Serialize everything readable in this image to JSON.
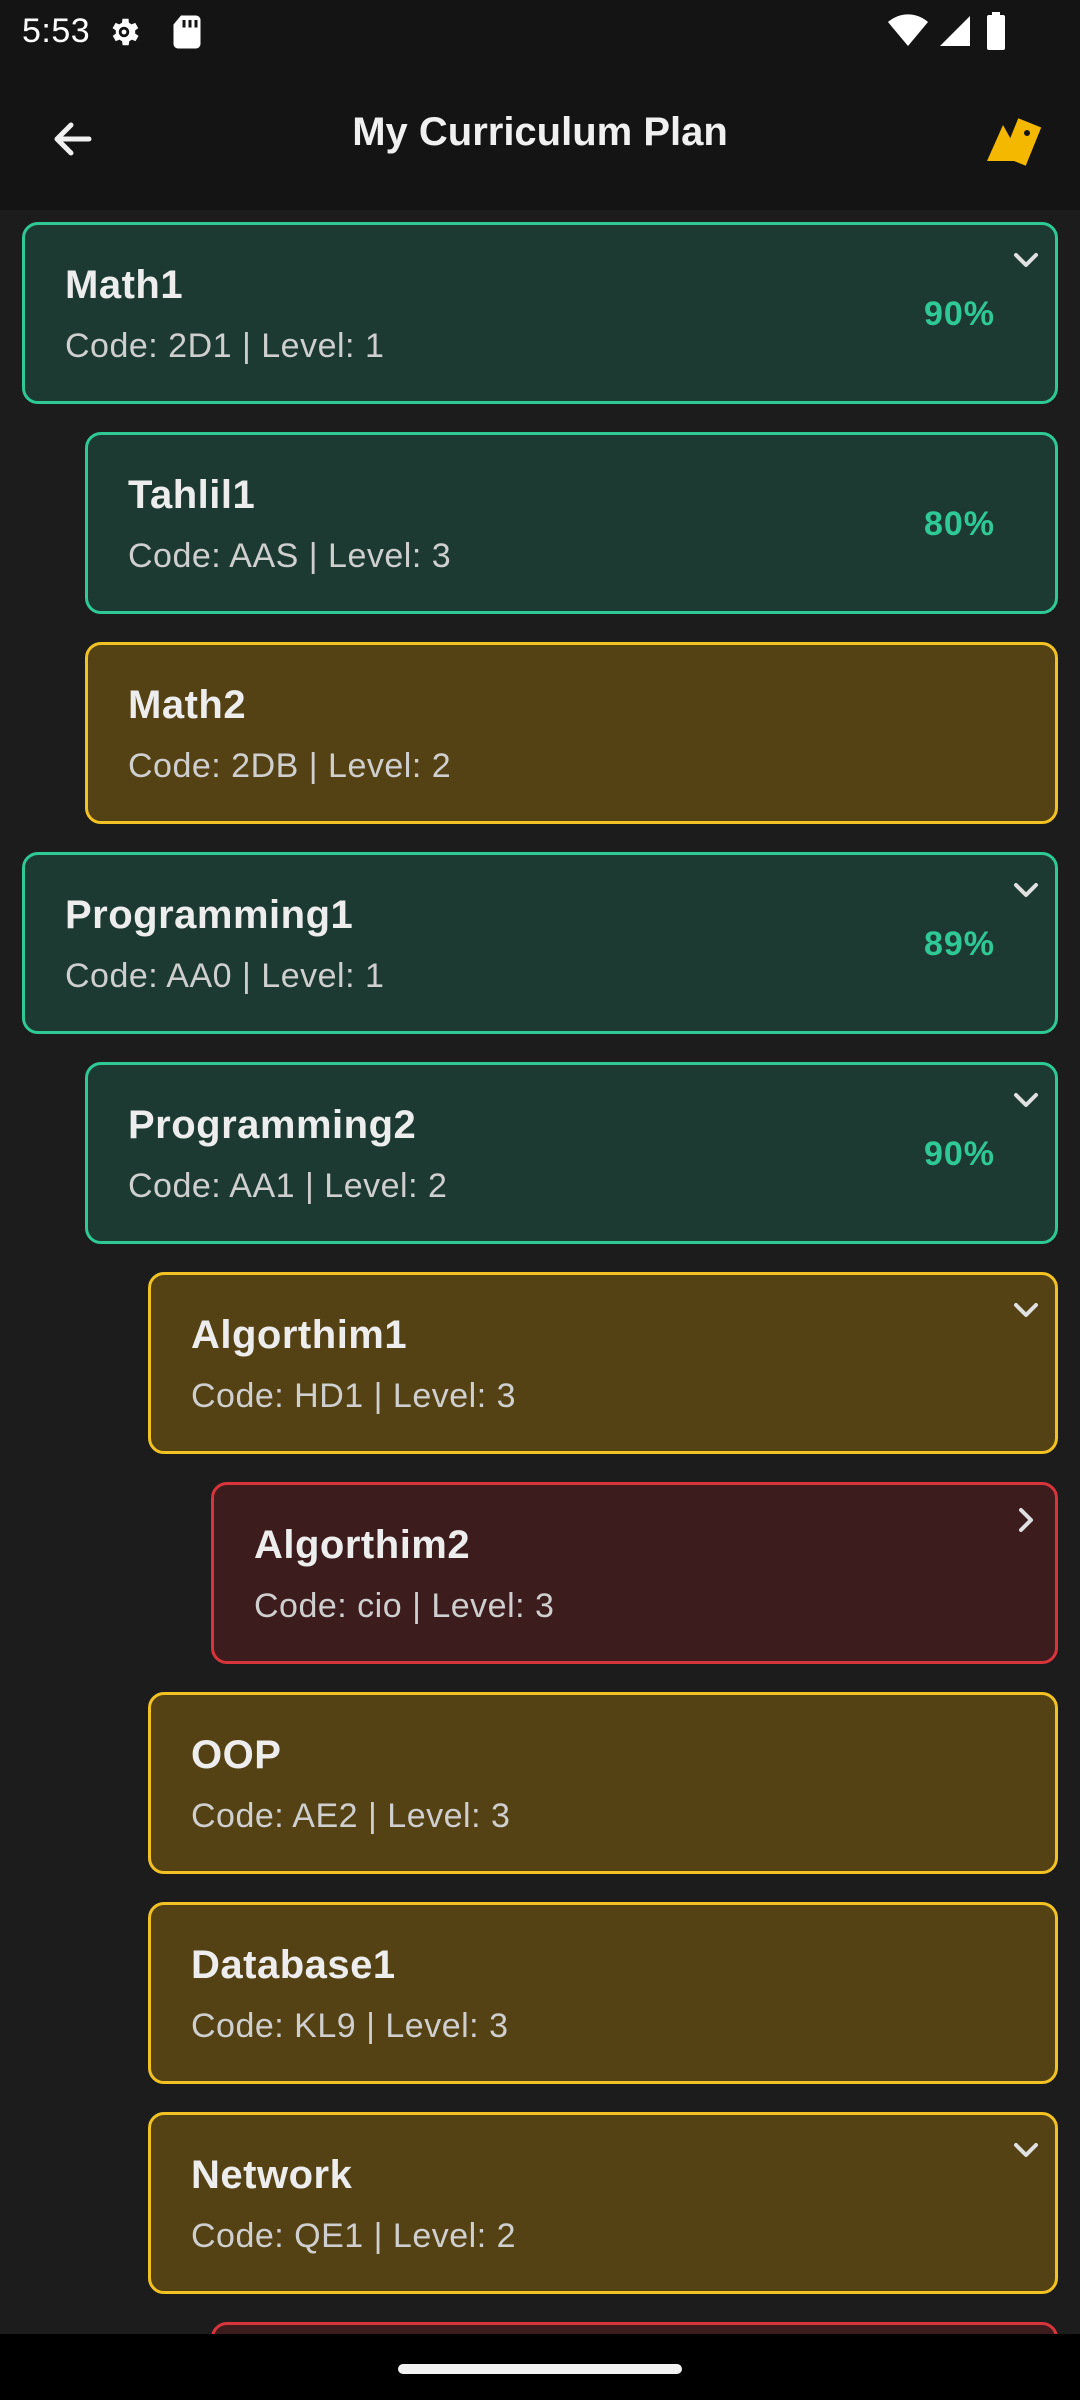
{
  "status_bar": {
    "time": "5:53",
    "icons": [
      "gear-icon",
      "sd-card-icon",
      "wifi-icon",
      "signal-icon",
      "battery-icon"
    ]
  },
  "app_bar": {
    "title": "My Curriculum Plan",
    "back_icon": "arrow-left-icon",
    "action_icon": "tag-icon"
  },
  "colors": {
    "passed_bg": "#1c3a32",
    "passed_border": "#2ec995",
    "available_bg": "#544214",
    "available_border": "#f2c224",
    "locked_bg": "#3c1c1c",
    "locked_border": "#d8343c",
    "accent": "#f5b800"
  },
  "courses": [
    {
      "title": "Math1",
      "sub": "Code: 2D1 | Level: 1",
      "percent": "90%",
      "status": "passed",
      "chevron": "down"
    },
    {
      "title": "Tahlil1",
      "sub": "Code: AAS | Level: 3",
      "percent": "80%",
      "status": "passed",
      "chevron": ""
    },
    {
      "title": "Math2",
      "sub": "Code: 2DB | Level: 2",
      "percent": "",
      "status": "available",
      "chevron": ""
    },
    {
      "title": "Programming1",
      "sub": "Code: AA0 | Level: 1",
      "percent": "89%",
      "status": "passed",
      "chevron": "down"
    },
    {
      "title": "Programming2",
      "sub": "Code: AA1 | Level: 2",
      "percent": "90%",
      "status": "passed",
      "chevron": "down"
    },
    {
      "title": "Algorthim1",
      "sub": "Code: HD1 | Level: 3",
      "percent": "",
      "status": "available",
      "chevron": "down"
    },
    {
      "title": "Algorthim2",
      "sub": "Code: cio | Level: 3",
      "percent": "",
      "status": "locked",
      "chevron": "right"
    },
    {
      "title": "OOP",
      "sub": "Code: AE2 | Level: 3",
      "percent": "",
      "status": "available",
      "chevron": ""
    },
    {
      "title": "Database1",
      "sub": "Code: KL9 | Level: 3",
      "percent": "",
      "status": "available",
      "chevron": ""
    },
    {
      "title": "Network",
      "sub": "Code: QE1 | Level: 2",
      "percent": "",
      "status": "available",
      "chevron": "down"
    }
  ]
}
